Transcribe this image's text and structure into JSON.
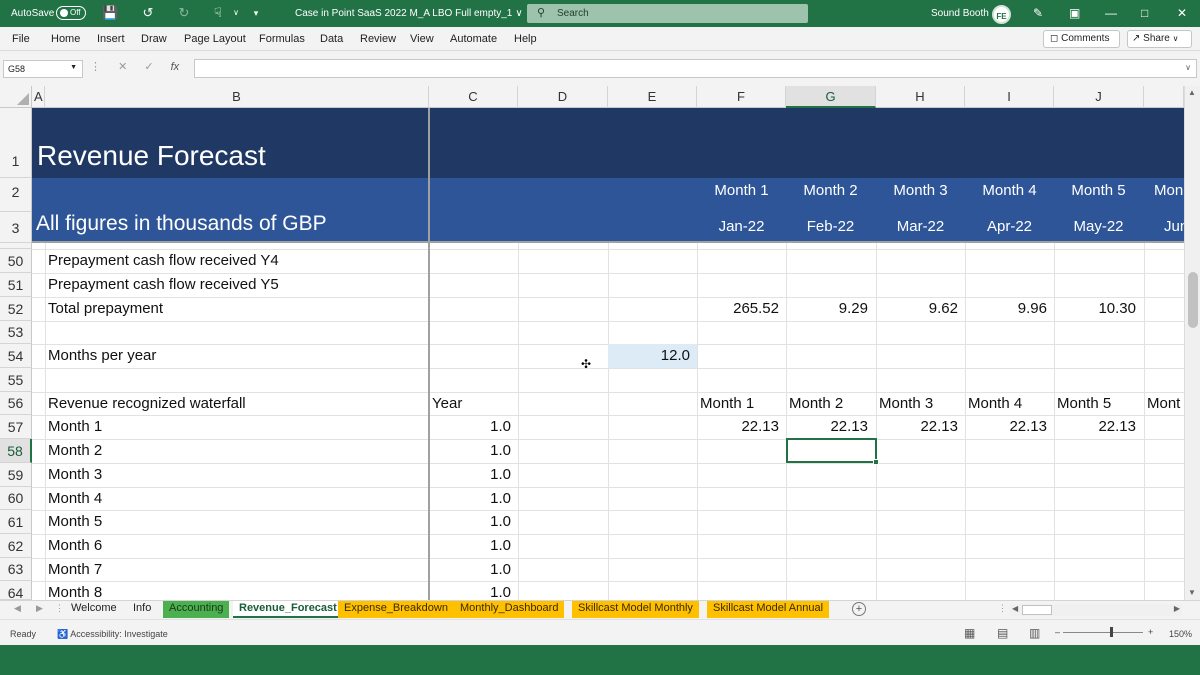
{
  "app": {
    "autosave_label": "AutoSave",
    "autosave_state": "Off",
    "doc_title": "Case in Point SaaS 2022 M_A LBO Full empty_1",
    "search_placeholder": "Search",
    "user_name": "Sound Booth",
    "user_initials": "FE",
    "accent_color": "#217346"
  },
  "menu": {
    "items": [
      "File",
      "Home",
      "Insert",
      "Draw",
      "Page Layout",
      "Formulas",
      "Data",
      "Review",
      "View",
      "Automate",
      "Help"
    ],
    "comments_label": "Comments",
    "share_label": "Share"
  },
  "formula_bar": {
    "name_box": "G58",
    "fx": "fx",
    "content": ""
  },
  "columns": [
    "A",
    "B",
    "C",
    "D",
    "E",
    "F",
    "G",
    "H",
    "I",
    "J"
  ],
  "selected_column": "G",
  "banner": {
    "title": "Revenue Forecast",
    "subtitle": "All figures in thousands of GBP",
    "months": [
      "Month 1",
      "Month 2",
      "Month 3",
      "Month 4",
      "Month 5",
      "Mon"
    ],
    "dates": [
      "Jan-22",
      "Feb-22",
      "Mar-22",
      "Apr-22",
      "May-22",
      "Jun"
    ],
    "band_dark": "#1f3864",
    "band_blue": "#2e5597"
  },
  "rows": {
    "frozen_numbers": [
      "1",
      "2",
      "3"
    ],
    "numbers": [
      "50",
      "51",
      "52",
      "53",
      "54",
      "55",
      "56",
      "57",
      "58",
      "59",
      "60",
      "61",
      "62",
      "63",
      "64"
    ],
    "selected_row": "58",
    "labels": {
      "r50": "Prepayment cash flow received Y4",
      "r51": "Prepayment cash flow received Y5",
      "r52": "Total prepayment",
      "r54": "Months per year",
      "r56": "Revenue recognized waterfall",
      "r57": "Month 1",
      "r58": "Month 2",
      "r59": "Month 3",
      "r60": "Month 4",
      "r61": "Month 5",
      "r62": "Month 6",
      "r63": "Month 7",
      "r64": "Month 8"
    },
    "total_prepayment": [
      "265.52",
      "9.29",
      "9.62",
      "9.96",
      "10.30"
    ],
    "months_per_year": "12.0",
    "year_header": "Year",
    "waterfall_headers": [
      "Month 1",
      "Month 2",
      "Month 3",
      "Month 4",
      "Month 5",
      "Mont"
    ],
    "year_values": [
      "1.0",
      "1.0",
      "1.0",
      "1.0",
      "1.0",
      "1.0",
      "1.0",
      "1.0"
    ],
    "month1_values": [
      "22.13",
      "22.13",
      "22.13",
      "22.13",
      "22.13"
    ]
  },
  "sheets": {
    "tabs": [
      "Welcome",
      "Info",
      "Accounting",
      "Revenue_Forecast",
      "Expense_Breakdown",
      "Monthly_Dashboard",
      "Skillcast Model Monthly",
      "Skillcast Model Annual"
    ],
    "active": "Revenue_Forecast",
    "tab_colors": {
      "green": "#4caf50",
      "orange": "#ffc000"
    }
  },
  "status": {
    "ready": "Ready",
    "accessibility": "Accessibility: Investigate",
    "zoom": "150%"
  }
}
